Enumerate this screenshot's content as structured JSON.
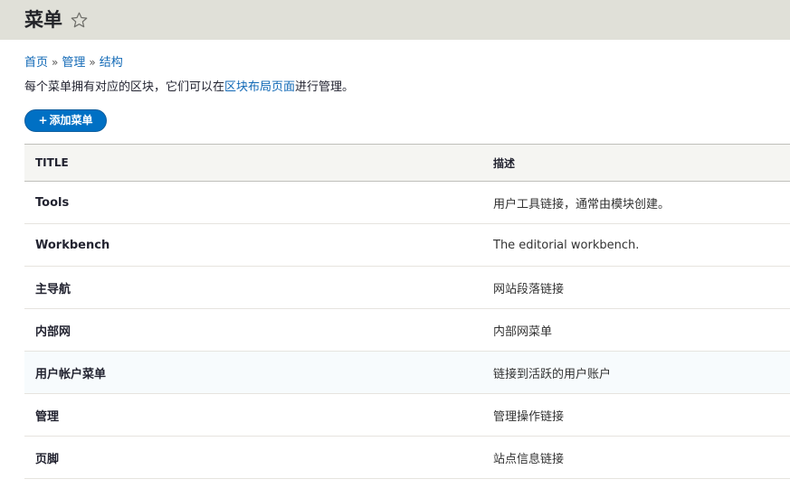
{
  "header": {
    "title": "菜单",
    "favorite_icon": "star-outline-icon"
  },
  "breadcrumb": {
    "items": [
      "首页",
      "管理",
      "结构"
    ],
    "separator": "»"
  },
  "description": {
    "before": "每个菜单拥有对应的区块，它们可以在",
    "link": "区块布局页面",
    "after": "进行管理。"
  },
  "add_button": {
    "plus": "+",
    "label": "添加菜单"
  },
  "table": {
    "headers": [
      "TITLE",
      "描述"
    ],
    "rows": [
      {
        "title": "Tools",
        "description": "用户工具链接，通常由模块创建。"
      },
      {
        "title": "Workbench",
        "description": "The editorial workbench."
      },
      {
        "title": "主导航",
        "description": "网站段落链接"
      },
      {
        "title": "内部网",
        "description": "内部网菜单"
      },
      {
        "title": "用户帐户菜单",
        "description": "链接到活跃的用户账户"
      },
      {
        "title": "管理",
        "description": "管理操作链接"
      },
      {
        "title": "页脚",
        "description": "站点信息链接"
      }
    ]
  },
  "colors": {
    "header_bg": "#e0e0d8",
    "link": "#1068b6",
    "primary_button": "#0070c4"
  }
}
